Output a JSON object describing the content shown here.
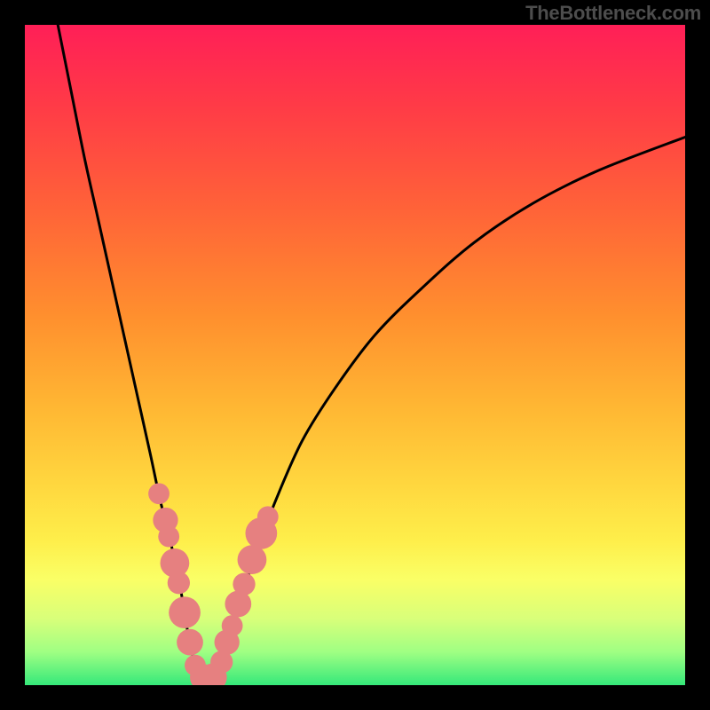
{
  "watermark": {
    "text": "TheBottleneck.com"
  },
  "gradient": {
    "stops": [
      {
        "offset": 0.0,
        "color": "#ff1f57"
      },
      {
        "offset": 0.12,
        "color": "#ff3a47"
      },
      {
        "offset": 0.28,
        "color": "#ff6338"
      },
      {
        "offset": 0.44,
        "color": "#ff8f2e"
      },
      {
        "offset": 0.58,
        "color": "#ffb733"
      },
      {
        "offset": 0.7,
        "color": "#ffd83f"
      },
      {
        "offset": 0.78,
        "color": "#feee4a"
      },
      {
        "offset": 0.84,
        "color": "#faff66"
      },
      {
        "offset": 0.9,
        "color": "#d8ff7a"
      },
      {
        "offset": 0.95,
        "color": "#9fff83"
      },
      {
        "offset": 1.0,
        "color": "#35e87a"
      }
    ]
  },
  "chart_data": {
    "type": "line",
    "title": "",
    "xlabel": "",
    "ylabel": "",
    "xlim": [
      0,
      100
    ],
    "ylim": [
      0,
      100
    ],
    "grid": false,
    "legend": false,
    "series": [
      {
        "name": "left-curve",
        "x": [
          5,
          7,
          9,
          11,
          13,
          15,
          17,
          19,
          20.5,
          22,
          23.5,
          24.5,
          25.5,
          26
        ],
        "y": [
          100,
          90,
          80,
          71,
          62,
          53,
          44,
          35,
          28,
          22,
          15,
          9,
          4,
          1
        ]
      },
      {
        "name": "right-curve",
        "x": [
          29,
          30,
          31.5,
          33,
          35,
          38,
          42,
          47,
          53,
          60,
          68,
          77,
          87,
          100
        ],
        "y": [
          1,
          4,
          9,
          14,
          20,
          28,
          37,
          45,
          53,
          60,
          67,
          73,
          78,
          83
        ]
      }
    ],
    "markers": [
      {
        "series": "left-curve",
        "x": 20.3,
        "y": 29,
        "r": 1.6
      },
      {
        "series": "left-curve",
        "x": 21.3,
        "y": 25,
        "r": 1.9
      },
      {
        "series": "left-curve",
        "x": 21.8,
        "y": 22.5,
        "r": 1.6
      },
      {
        "series": "left-curve",
        "x": 22.7,
        "y": 18.5,
        "r": 2.2
      },
      {
        "series": "left-curve",
        "x": 23.3,
        "y": 15.5,
        "r": 1.7
      },
      {
        "series": "left-curve",
        "x": 24.2,
        "y": 11,
        "r": 2.4
      },
      {
        "series": "left-curve",
        "x": 25.0,
        "y": 6.5,
        "r": 2.0
      },
      {
        "series": "left-curve",
        "x": 25.8,
        "y": 3.0,
        "r": 1.6
      },
      {
        "series": "left-curve",
        "x": 27.0,
        "y": 1.2,
        "r": 2.0
      },
      {
        "series": "right-curve",
        "x": 28.5,
        "y": 1.2,
        "r": 2.1
      },
      {
        "series": "right-curve",
        "x": 29.8,
        "y": 3.5,
        "r": 1.7
      },
      {
        "series": "right-curve",
        "x": 30.6,
        "y": 6.5,
        "r": 1.9
      },
      {
        "series": "right-curve",
        "x": 31.4,
        "y": 9.0,
        "r": 1.6
      },
      {
        "series": "right-curve",
        "x": 32.3,
        "y": 12.3,
        "r": 2.0
      },
      {
        "series": "right-curve",
        "x": 33.2,
        "y": 15.3,
        "r": 1.7
      },
      {
        "series": "right-curve",
        "x": 34.4,
        "y": 19.0,
        "r": 2.2
      },
      {
        "series": "right-curve",
        "x": 35.8,
        "y": 23.0,
        "r": 2.4
      },
      {
        "series": "right-curve",
        "x": 36.8,
        "y": 25.5,
        "r": 1.6
      }
    ],
    "marker_color": "#e68080",
    "curve_stroke": "#000000",
    "curve_width": 3
  }
}
